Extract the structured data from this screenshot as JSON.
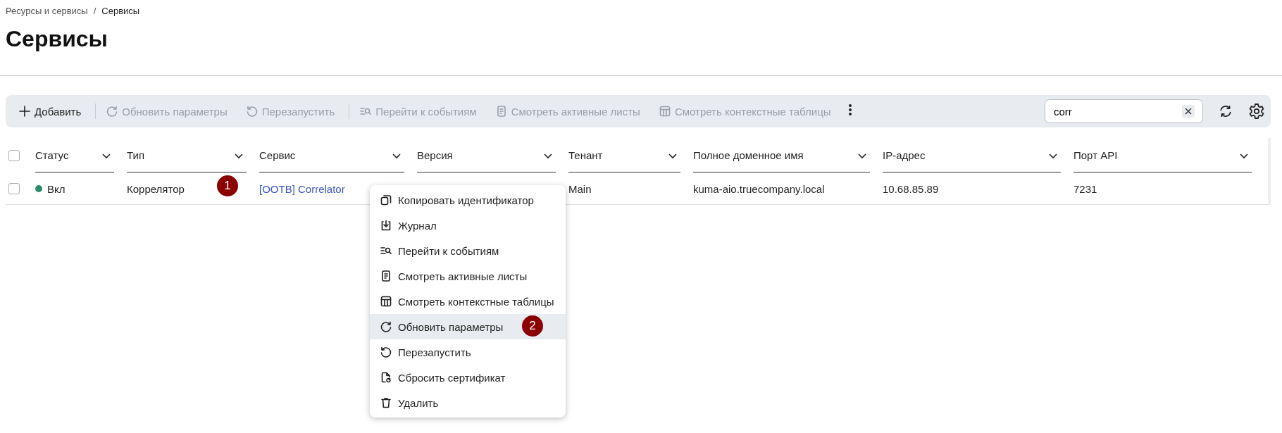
{
  "breadcrumb": [
    {
      "label": "Ресурсы и сервисы",
      "current": false
    },
    {
      "label": "Сервисы",
      "current": true
    }
  ],
  "breadcrumb_separator": "/",
  "page_title": "Сервисы",
  "toolbar": {
    "buttons": [
      {
        "kind": "add",
        "label": "Добавить",
        "disabled": false
      },
      {
        "kind": "refresh",
        "label": "Обновить параметры",
        "disabled": true
      },
      {
        "kind": "restart",
        "label": "Перезапустить",
        "disabled": true
      },
      {
        "kind": "events",
        "label": "Перейти к событиям",
        "disabled": true
      },
      {
        "kind": "list",
        "label": "Смотреть активные листы",
        "disabled": true
      },
      {
        "kind": "table",
        "label": "Смотреть контекстные таблицы",
        "disabled": true
      }
    ],
    "search": {
      "value": "corr"
    }
  },
  "table": {
    "columns": [
      "Статус",
      "Тип",
      "Сервис",
      "Версия",
      "Тенант",
      "Полное доменное имя",
      "IP-адрес",
      "Порт API"
    ],
    "select_all_checked": false,
    "rows": [
      {
        "checked": false,
        "status": "Вкл",
        "color": "#2a8a6a",
        "type": "Коррелятор",
        "service": "[OOTB] Correlator",
        "tenant": "Main",
        "fqdn": "kuma-aio.truecompany.local",
        "ip": "10.68.85.89",
        "port": "7231"
      }
    ]
  },
  "context_menu": [
    {
      "kind": "copy",
      "label": "Копировать идентификатор",
      "selected": false
    },
    {
      "kind": "download",
      "label": "Журнал",
      "selected": false
    },
    {
      "kind": "events",
      "label": "Перейти к событиям",
      "selected": false
    },
    {
      "kind": "list",
      "label": "Смотреть активные листы",
      "selected": false
    },
    {
      "kind": "table",
      "label": "Смотреть контекстные таблицы",
      "selected": false
    },
    {
      "kind": "refresh",
      "label": "Обновить параметры",
      "selected": true
    },
    {
      "kind": "restart",
      "label": "Перезапустить",
      "selected": false
    },
    {
      "kind": "certificate",
      "label": "Сбросить сертификат",
      "selected": false
    },
    {
      "kind": "delete",
      "label": "Удалить",
      "selected": false
    }
  ],
  "annotations": [
    {
      "text": "1"
    },
    {
      "text": "2"
    }
  ]
}
